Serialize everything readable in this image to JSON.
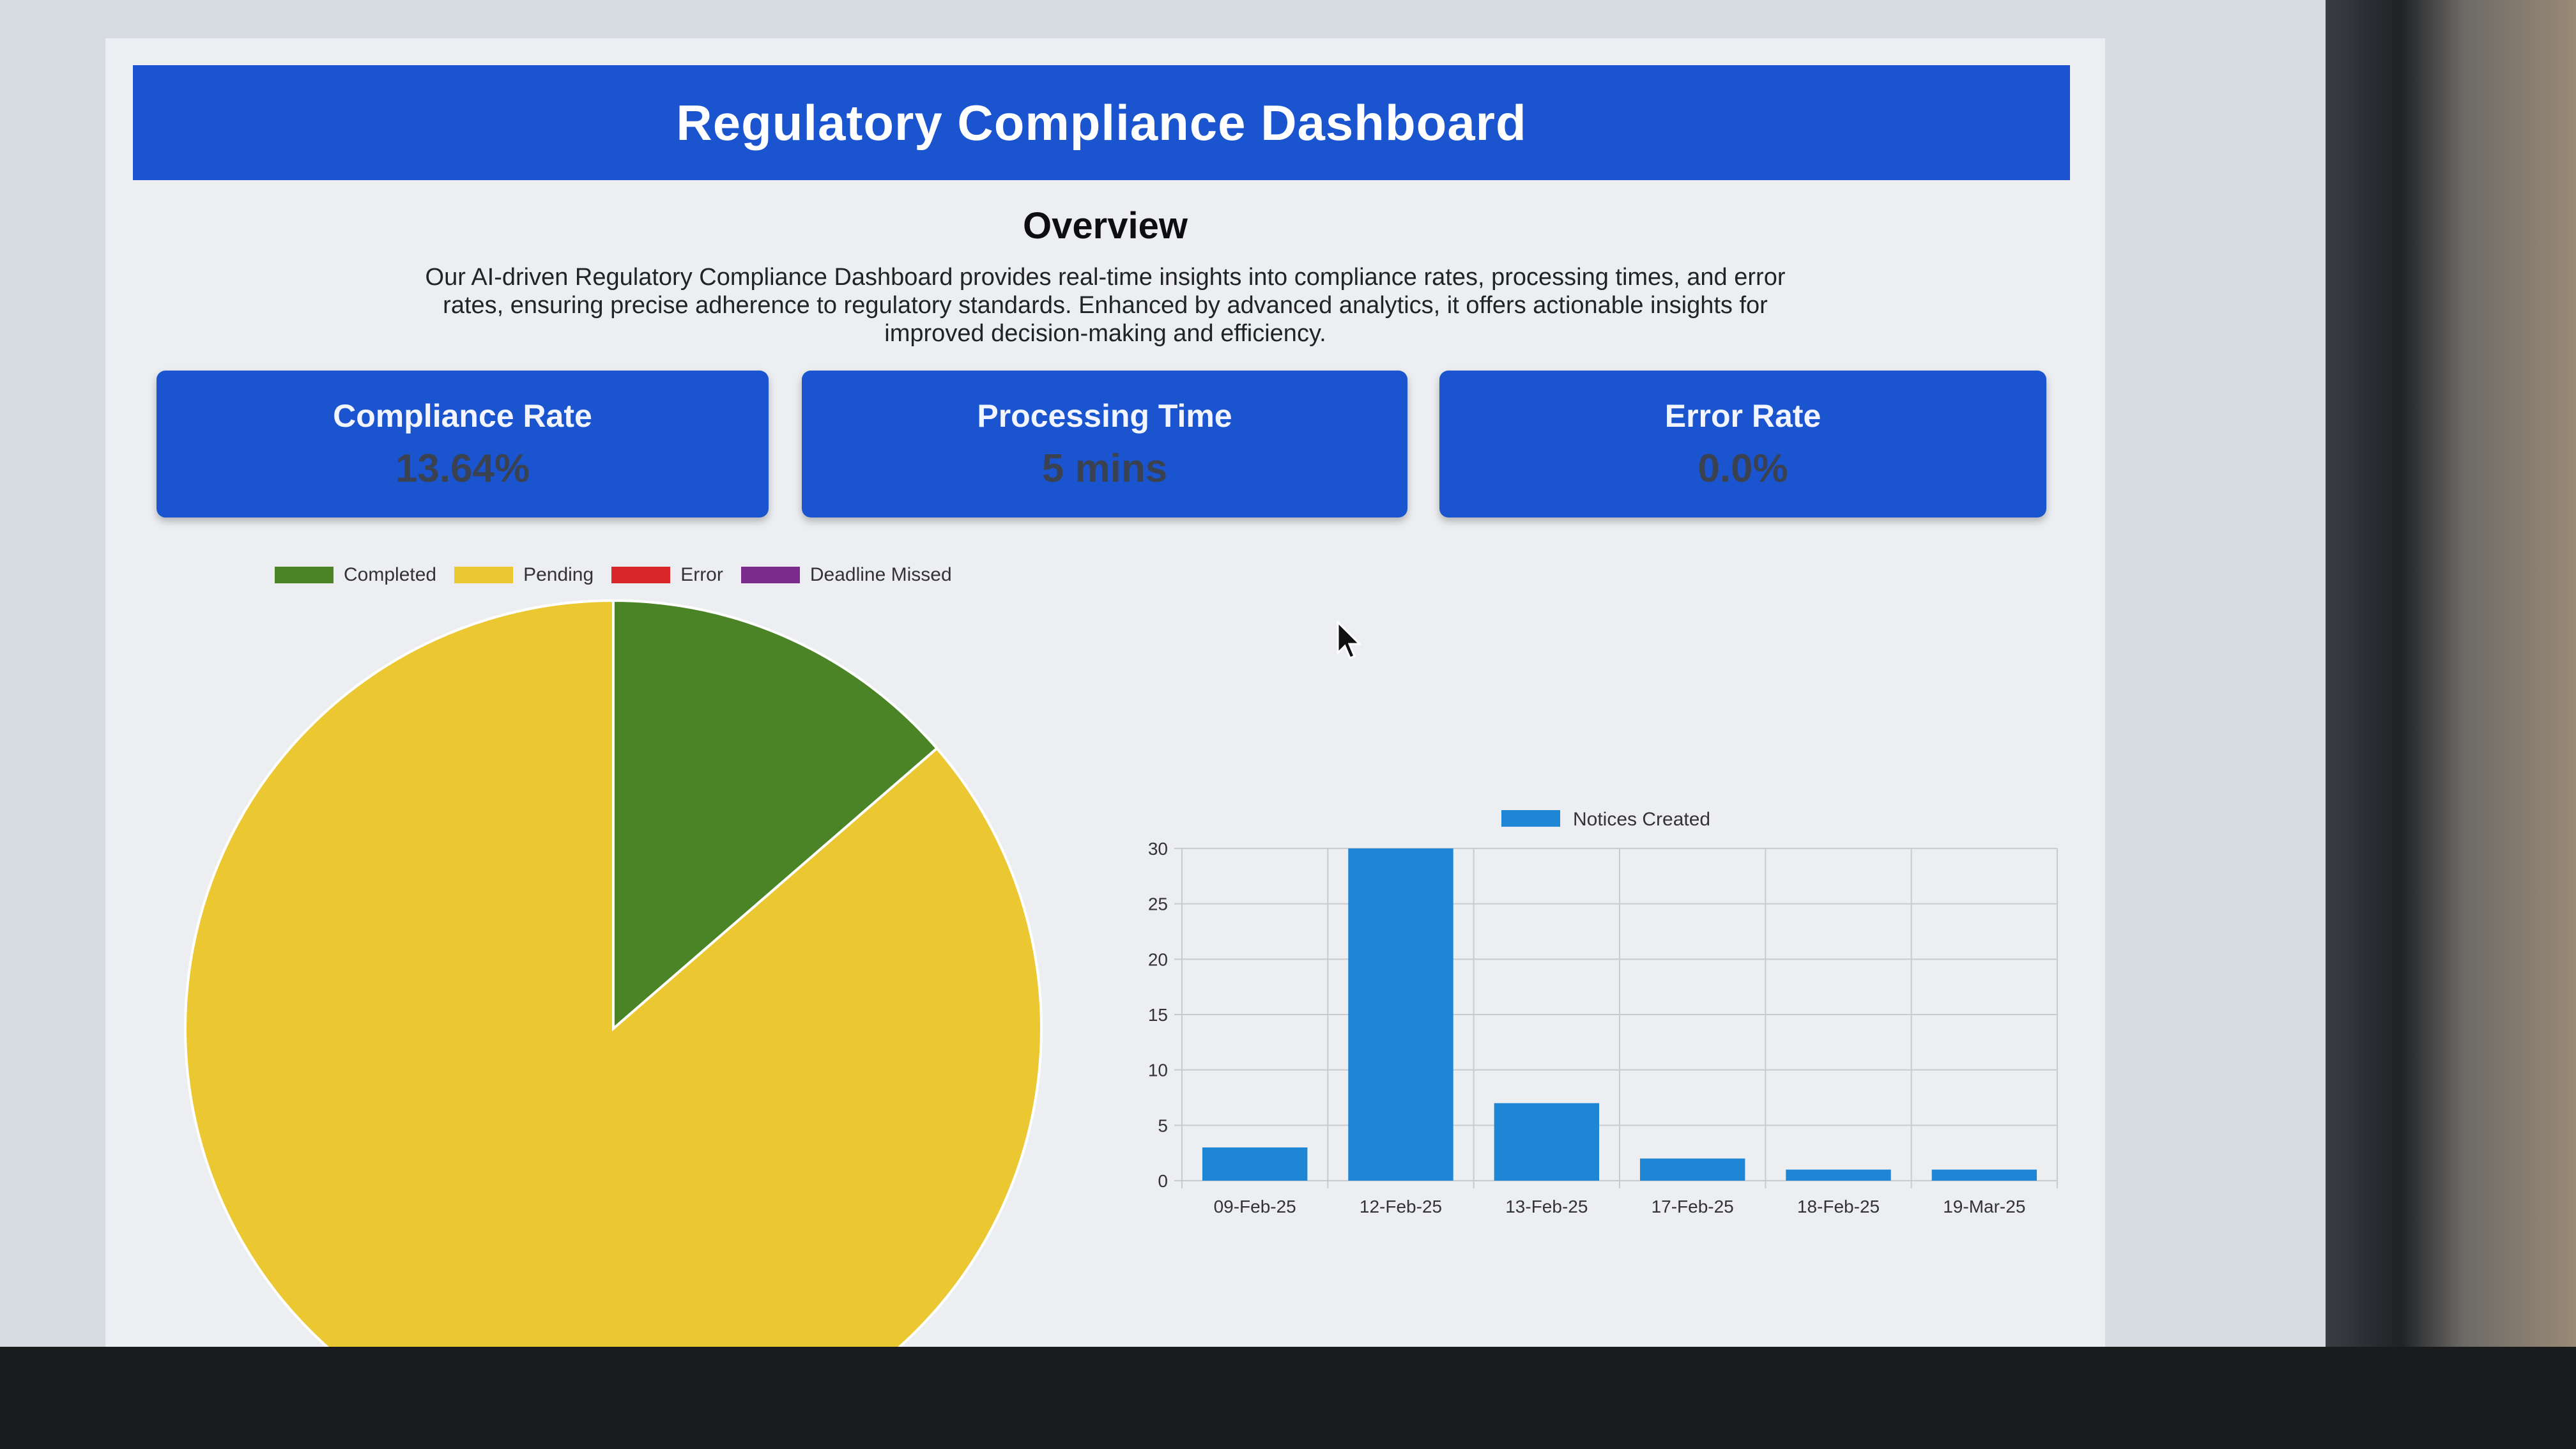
{
  "header": {
    "title": "Regulatory Compliance Dashboard"
  },
  "overview": {
    "heading": "Overview",
    "description": "Our AI-driven Regulatory Compliance Dashboard provides real-time insights into compliance rates, processing times, and error rates, ensuring precise adherence to regulatory standards. Enhanced by advanced analytics, it offers actionable insights for improved decision-making and efficiency."
  },
  "kpis": [
    {
      "label": "Compliance Rate",
      "value": "13.64%"
    },
    {
      "label": "Processing Time",
      "value": "5 mins"
    },
    {
      "label": "Error Rate",
      "value": "0.0%"
    }
  ],
  "colors": {
    "brand": "#1a55cf",
    "completed": "#4a8427",
    "pending": "#ebc731",
    "error": "#d8262b",
    "deadline_missed": "#7b2b8c",
    "bar": "#1f86d6"
  },
  "chart_data": [
    {
      "type": "pie",
      "legend_position": "top",
      "labels": [
        "Completed",
        "Pending",
        "Error",
        "Deadline Missed"
      ],
      "values": [
        13.64,
        86.36,
        0,
        0
      ]
    },
    {
      "type": "bar",
      "legend_position": "top",
      "categories": [
        "09-Feb-25",
        "12-Feb-25",
        "13-Feb-25",
        "17-Feb-25",
        "18-Feb-25",
        "19-Mar-25"
      ],
      "series": [
        {
          "name": "Notices Created",
          "values": [
            3,
            30,
            7,
            2,
            1,
            1
          ]
        }
      ],
      "ylim": [
        0,
        30
      ],
      "yticks": [
        0,
        5,
        10,
        15,
        20,
        25,
        30
      ],
      "grid": true
    }
  ]
}
